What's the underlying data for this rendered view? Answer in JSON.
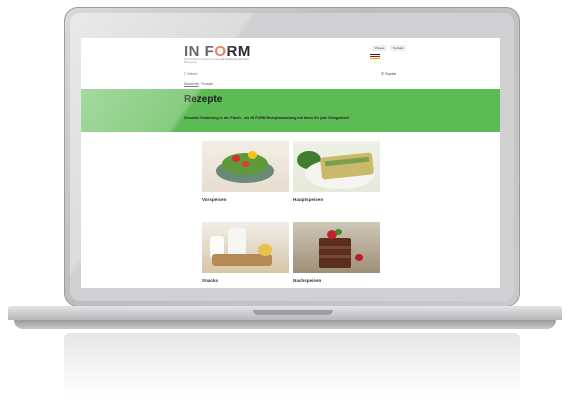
{
  "site": {
    "logo_prefix": "IN F",
    "logo_o": "O",
    "logo_suffix": "RM",
    "tagline": "Deutschlands Initiative für gesunde Ernährung und mehr Bewegung",
    "top_link_1": "Presse",
    "top_link_2": "Kontakt"
  },
  "nav": {
    "menu_label": "≡ Menü",
    "search_label": "⚲ Suche"
  },
  "breadcrumb": {
    "home": "Startseite",
    "separator": " / ",
    "current": "Rezepte"
  },
  "banner": {
    "title": "Rezepte",
    "subtitle": "Gesunde Ernährung in der Praxis - die IN FORM Rezeptsammlung mit Ideen für jede Gelegenheit.",
    "color": "#5dbb55"
  },
  "cards": [
    {
      "label": "Vorspeisen"
    },
    {
      "label": "Hauptspeisen"
    },
    {
      "label": "Snacks"
    },
    {
      "label": "Nachspeisen"
    }
  ],
  "colors": {
    "logo_accent": "#e2542b",
    "frame": "#c8c8ca"
  }
}
